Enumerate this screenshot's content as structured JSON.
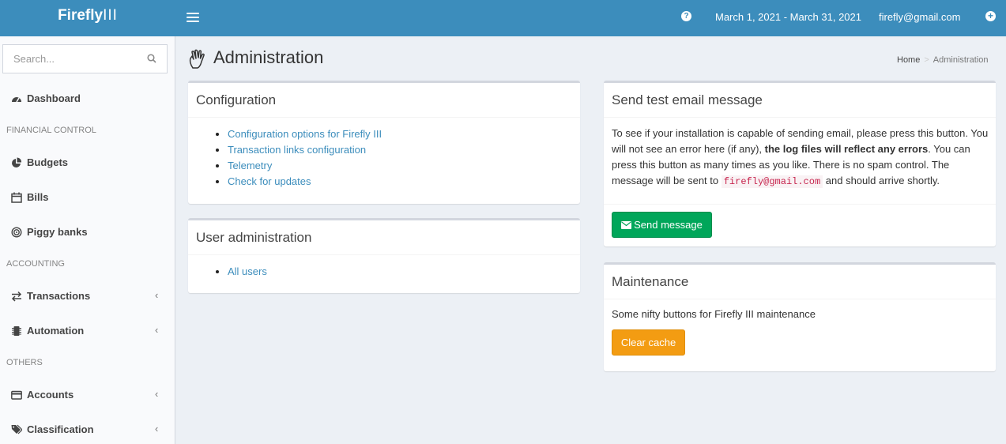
{
  "header": {
    "logo_bold": "Firefly",
    "logo_thin": "III",
    "date_range": "March 1, 2021 - March 31, 2021",
    "user_email": "firefly@gmail.com",
    "help_glyph": "?",
    "plus_glyph": "+"
  },
  "sidebar": {
    "search_placeholder": "Search...",
    "items": {
      "dashboard": "Dashboard",
      "budgets": "Budgets",
      "bills": "Bills",
      "piggy_banks": "Piggy banks",
      "transactions": "Transactions",
      "automation": "Automation",
      "accounts": "Accounts",
      "classification": "Classification"
    },
    "headers": {
      "financial_control": "FINANCIAL CONTROL",
      "accounting": "ACCOUNTING",
      "others": "OTHERS"
    },
    "chevron": "‹"
  },
  "page": {
    "title": "Administration",
    "breadcrumb_home": "Home",
    "breadcrumb_sep": ">",
    "breadcrumb_current": "Administration"
  },
  "configuration": {
    "title": "Configuration",
    "links": [
      "Configuration options for Firefly III",
      "Transaction links configuration",
      "Telemetry",
      "Check for updates"
    ]
  },
  "user_admin": {
    "title": "User administration",
    "links": [
      "All users"
    ]
  },
  "send_email": {
    "title": "Send test email message",
    "text_1": "To see if your installation is capable of sending email, please press this button. You will not see an error here (if any), ",
    "text_bold": "the log files will reflect any errors",
    "text_2": ". You can press this button as many times as you like. There is no spam control. The message will be sent to ",
    "email_code": "firefly@gmail.com",
    "text_3": " and should arrive shortly.",
    "button": "Send message"
  },
  "maintenance": {
    "title": "Maintenance",
    "text": "Some nifty buttons for Firefly III maintenance",
    "button": "Clear cache"
  },
  "colors": {
    "header_bg": "#3c8dbc",
    "link": "#3c8dbc",
    "success": "#00a65a",
    "warning": "#f39c12"
  }
}
